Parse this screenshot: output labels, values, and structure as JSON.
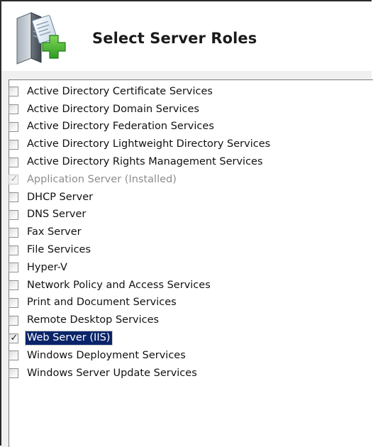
{
  "header": {
    "title": "Select Server Roles",
    "icon": "server-add-role-icon"
  },
  "roles": [
    {
      "label": "Active Directory Certificate Services",
      "checked": false,
      "disabled": false,
      "selected": false
    },
    {
      "label": "Active Directory Domain Services",
      "checked": false,
      "disabled": false,
      "selected": false
    },
    {
      "label": "Active Directory Federation Services",
      "checked": false,
      "disabled": false,
      "selected": false
    },
    {
      "label": "Active Directory Lightweight Directory Services",
      "checked": false,
      "disabled": false,
      "selected": false
    },
    {
      "label": "Active Directory Rights Management Services",
      "checked": false,
      "disabled": false,
      "selected": false
    },
    {
      "label": "Application Server  (Installed)",
      "checked": true,
      "disabled": true,
      "selected": false
    },
    {
      "label": "DHCP Server",
      "checked": false,
      "disabled": false,
      "selected": false
    },
    {
      "label": "DNS Server",
      "checked": false,
      "disabled": false,
      "selected": false
    },
    {
      "label": "Fax Server",
      "checked": false,
      "disabled": false,
      "selected": false
    },
    {
      "label": "File Services",
      "checked": false,
      "disabled": false,
      "selected": false
    },
    {
      "label": "Hyper-V",
      "checked": false,
      "disabled": false,
      "selected": false
    },
    {
      "label": "Network Policy and Access Services",
      "checked": false,
      "disabled": false,
      "selected": false
    },
    {
      "label": "Print and Document Services",
      "checked": false,
      "disabled": false,
      "selected": false
    },
    {
      "label": "Remote Desktop Services",
      "checked": false,
      "disabled": false,
      "selected": false
    },
    {
      "label": "Web Server (IIS)",
      "checked": true,
      "disabled": false,
      "selected": true
    },
    {
      "label": "Windows Deployment Services",
      "checked": false,
      "disabled": false,
      "selected": false
    },
    {
      "label": "Windows Server Update Services",
      "checked": false,
      "disabled": false,
      "selected": false
    }
  ],
  "colors": {
    "selection_bg": "#0a246a",
    "selection_fg": "#ffffff",
    "disabled_text": "#8d8d8d",
    "plus_green": "#3fae2a"
  }
}
